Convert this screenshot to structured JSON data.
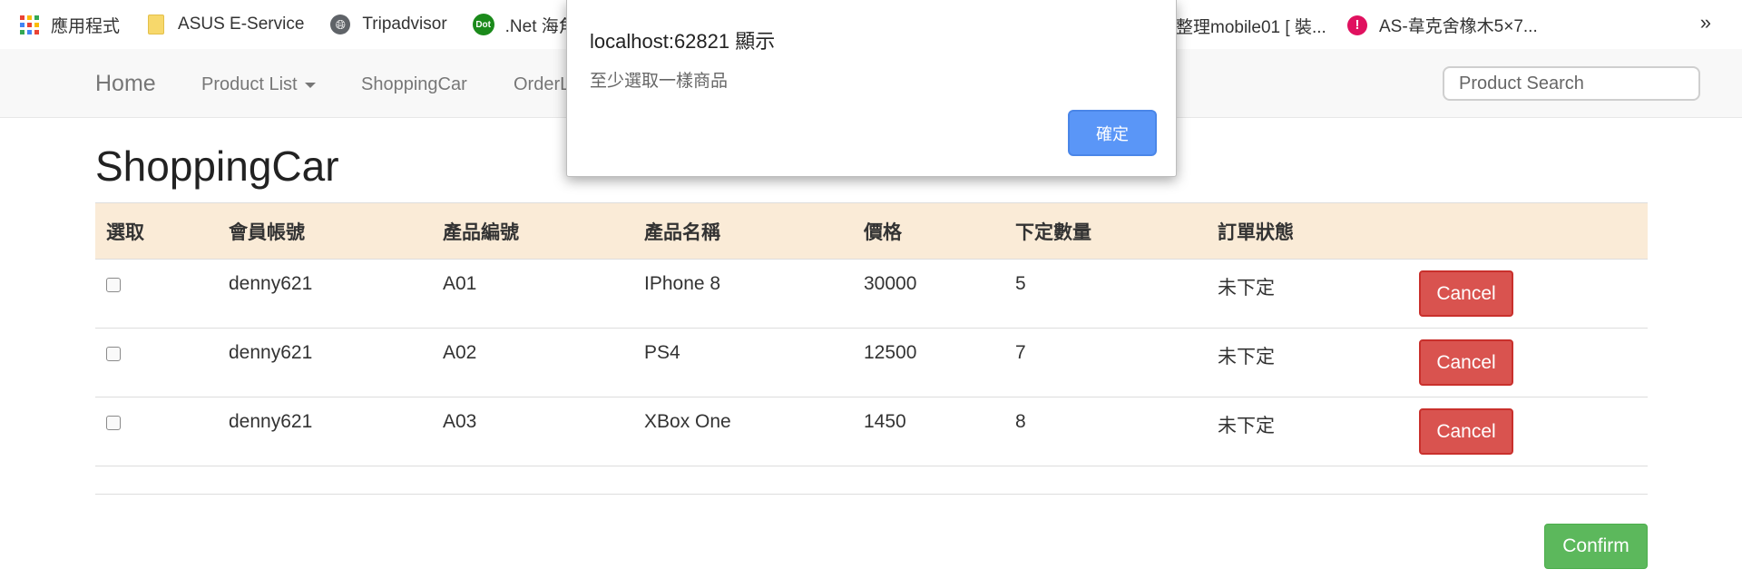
{
  "bookmarks": {
    "items": [
      {
        "label": "應用程式",
        "icon": "apps-grid-icon"
      },
      {
        "label": "ASUS E-Service",
        "icon": "folder-icon"
      },
      {
        "label": "Tripadvisor",
        "icon": "globe-icon"
      },
      {
        "label": ".Net 海角點",
        "icon": "dot-icon",
        "icon_text": "Dot"
      },
      {
        "label": "...整理mobile01 [ 裝...",
        "icon": "none"
      },
      {
        "label": "AS-韋克舍橡木5×7...",
        "icon": "exclamation-icon"
      }
    ],
    "visible_items": [
      {
        "label": "應用程式"
      },
      {
        "label": "ASUS E-Service"
      },
      {
        "label": "Tripadvisor"
      },
      {
        "label": ".Net 海角點"
      }
    ],
    "right_items": [
      {
        "label": "整理mobile01 [ 裝..."
      },
      {
        "label": "AS-韋克舍橡木5×7..."
      }
    ],
    "more": "»",
    "dot_icon_text": "Dot",
    "excl_icon_text": "!"
  },
  "navbar": {
    "brand": "Home",
    "items": [
      "Product List",
      "ShoppingCar",
      "OrderL"
    ],
    "search_placeholder": "Product Search"
  },
  "page": {
    "title": "ShoppingCar"
  },
  "table": {
    "headers": [
      "選取",
      "會員帳號",
      "產品編號",
      "產品名稱",
      "價格",
      "下定數量",
      "訂單狀態"
    ],
    "rows": [
      {
        "member": "denny621",
        "product_id": "A01",
        "product_name": "IPhone 8",
        "price": "30000",
        "quantity": "5",
        "status": "未下定",
        "action": "Cancel"
      },
      {
        "member": "denny621",
        "product_id": "A02",
        "product_name": "PS4",
        "price": "12500",
        "quantity": "7",
        "status": "未下定",
        "action": "Cancel"
      },
      {
        "member": "denny621",
        "product_id": "A03",
        "product_name": "XBox One",
        "price": "1450",
        "quantity": "8",
        "status": "未下定",
        "action": "Cancel"
      }
    ]
  },
  "footer": {
    "confirm_label": "Confirm"
  },
  "dialog": {
    "title": "localhost:62821 顯示",
    "message": "至少選取一樣商品",
    "ok_label": "確定"
  },
  "colors": {
    "header_bg": "#faebd7",
    "cancel_button": "#d9534f",
    "confirm_button": "#5cb85c",
    "ok_button": "#5a96f7"
  }
}
